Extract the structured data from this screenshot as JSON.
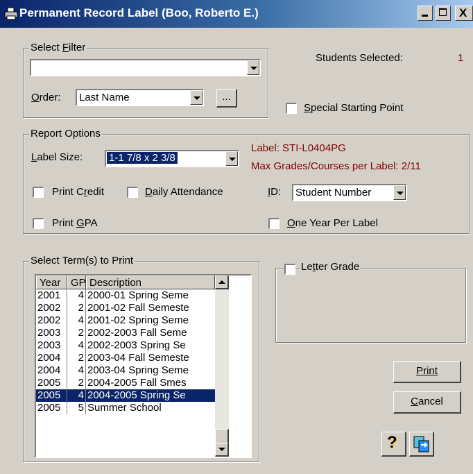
{
  "window": {
    "title": "Permanent Record Label (Boo, Roberto E.)",
    "controls": [
      "minimize",
      "maximize",
      "close"
    ]
  },
  "filter": {
    "group_label": "Select Filter",
    "filter_value": "",
    "order_label": "Order:",
    "order_value": "Last Name",
    "ellipsis_button": "..."
  },
  "students": {
    "label": "Students Selected:",
    "count": "1"
  },
  "special_start": {
    "label": "Special Starting Point",
    "checked": false
  },
  "report": {
    "group_label": "Report Options",
    "label_size_label": "Label Size:",
    "label_size_value": "1-1 7/8 x 2 3/8",
    "label_info": "Label: STI-L0404PG",
    "max_info": "Max Grades/Courses per Label: 2/11",
    "print_credit": "Print Credit",
    "daily_attendance": "Daily Attendance",
    "id_label": "ID:",
    "id_value": "Student Number",
    "print_gpa": "Print GPA",
    "one_year": "One Year Per Label"
  },
  "terms": {
    "group_label": "Select Term(s) to Print",
    "headers": [
      "Year",
      "GP",
      "Description"
    ],
    "rows": [
      {
        "year": "2001",
        "gp": "4",
        "desc": "2000-01 Spring Seme"
      },
      {
        "year": "2002",
        "gp": "2",
        "desc": "2001-02 Fall Semeste"
      },
      {
        "year": "2002",
        "gp": "4",
        "desc": "2001-02 Spring Seme"
      },
      {
        "year": "2003",
        "gp": "2",
        "desc": "2002-2003 Fall Seme"
      },
      {
        "year": "2003",
        "gp": "4",
        "desc": "2002-2003 Spring Se"
      },
      {
        "year": "2004",
        "gp": "2",
        "desc": "2003-04 Fall Semeste"
      },
      {
        "year": "2004",
        "gp": "4",
        "desc": "2003-04 Spring Seme"
      },
      {
        "year": "2005",
        "gp": "2",
        "desc": "2004-2005 Fall Smes"
      },
      {
        "year": "2005",
        "gp": "4",
        "desc": "2004-2005 Spring Se",
        "selected": true
      },
      {
        "year": "2005",
        "gp": "5",
        "desc": "Summer School"
      }
    ]
  },
  "letter_grade": {
    "label": "Letter Grade",
    "checked": false
  },
  "buttons": {
    "print": "Print",
    "cancel": "Cancel"
  },
  "icons": [
    "printer-icon",
    "help-icon",
    "copy-icon"
  ],
  "colors": {
    "title_start": "#0a246a",
    "title_end": "#a6caf0",
    "face": "#d4d0c8",
    "selection": "#0a246a",
    "info_red": "#800000"
  }
}
